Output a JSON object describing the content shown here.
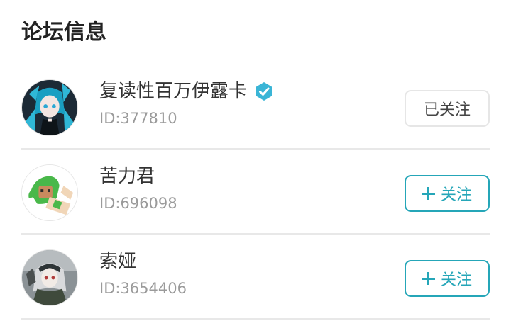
{
  "section": {
    "title": "论坛信息"
  },
  "accent_color": "#25a6b8",
  "users": [
    {
      "name": "复读性百万伊露卡",
      "verified": true,
      "verified_icon": "verified-badge-icon",
      "id": "ID:377810",
      "follow_label": "已关注",
      "following": true
    },
    {
      "name": "苦力君",
      "verified": false,
      "id": "ID:696098",
      "follow_label": "关注",
      "follow_icon": "plus-icon",
      "following": false
    },
    {
      "name": "索娅",
      "verified": false,
      "id": "ID:3654406",
      "follow_label": "关注",
      "follow_icon": "plus-icon",
      "following": false
    }
  ]
}
